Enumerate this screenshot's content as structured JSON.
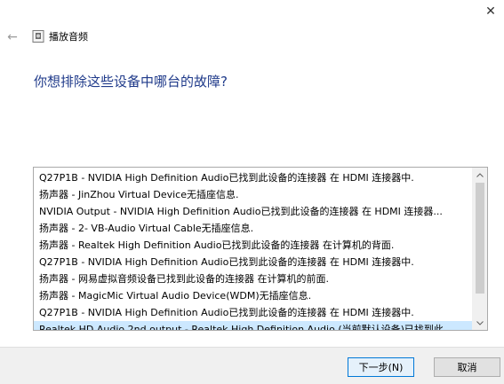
{
  "window": {
    "close_glyph": "✕"
  },
  "header": {
    "back_glyph": "←",
    "app_icon": "speaker-doc-icon",
    "title": "播放音频"
  },
  "question": "你想排除这些设备中哪台的故障?",
  "devices": [
    "Q27P1B - NVIDIA High Definition Audio已找到此设备的连接器 在 HDMI 连接器中.",
    "扬声器 - JinZhou Virtual Device无插座信息.",
    "NVIDIA Output - NVIDIA High Definition Audio已找到此设备的连接器 在 HDMI 连接器...",
    "扬声器 - 2- VB-Audio Virtual Cable无插座信息.",
    "扬声器 - Realtek High Definition Audio已找到此设备的连接器 在计算机的背面.",
    "Q27P1B - NVIDIA High Definition Audio已找到此设备的连接器 在 HDMI 连接器中.",
    "扬声器 - 网易虚拟音频设备已找到此设备的连接器 在计算机的前面.",
    "扬声器 - MagicMic Virtual Audio Device(WDM)无插座信息.",
    "Q27P1B - NVIDIA High Definition Audio已找到此设备的连接器 在 HDMI 连接器中.",
    "Realtek HD Audio 2nd output - Realtek High Definition Audio (当前默认设备)已找到此..."
  ],
  "selected_index": 9,
  "buttons": {
    "next": "下一步(N)",
    "cancel": "取消"
  },
  "colors": {
    "question": "#1f3a8a",
    "selection": "#cce8ff",
    "primary_border": "#0078d7"
  }
}
